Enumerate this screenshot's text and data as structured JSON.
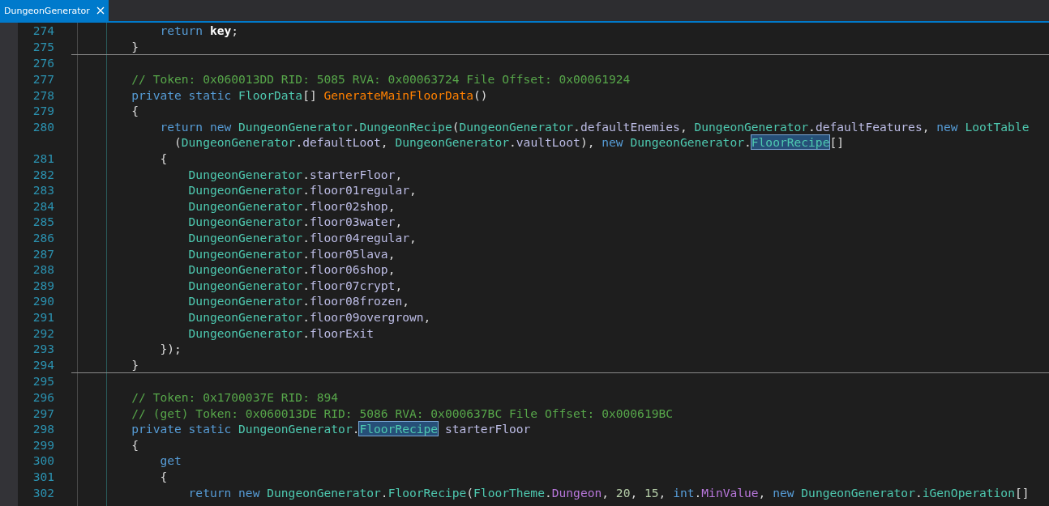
{
  "tabs": [
    {
      "label": "DungeonGenerator",
      "selected": true
    }
  ],
  "lines": [
    {
      "number": "274",
      "separator_below": false,
      "tokens": [
        {
          "kind": "keyword",
          "text": "            return"
        },
        {
          "kind": "bold",
          "text": " key"
        },
        {
          "kind": "plain",
          "text": ";"
        }
      ]
    },
    {
      "number": "275",
      "separator_below": true,
      "tokens": [
        {
          "kind": "plain",
          "text": "        }"
        }
      ]
    },
    {
      "number": "276",
      "separator_below": false
    },
    {
      "number": "277",
      "separator_below": false,
      "tokens": [
        {
          "kind": "comment",
          "text": "        // Token: 0x060013DD RID: 5085 RVA: 0x00063724 File Offset: 0x00061924"
        }
      ]
    },
    {
      "number": "278",
      "separator_below": false,
      "tokens": [
        {
          "kind": "keyword",
          "text": "        private static"
        },
        {
          "kind": "type",
          "text": " FloorData"
        },
        {
          "kind": "plain",
          "text": "[] "
        },
        {
          "kind": "method",
          "text": "GenerateMainFloorData"
        },
        {
          "kind": "plain",
          "text": "()"
        }
      ]
    },
    {
      "number": "279",
      "separator_below": false,
      "tokens": [
        {
          "kind": "plain",
          "text": "        {"
        }
      ]
    },
    {
      "number": "280",
      "separator_below": false,
      "tokens": [
        {
          "kind": "keyword",
          "text": "            return new"
        },
        {
          "kind": "type",
          "text": " DungeonGenerator"
        },
        {
          "kind": "plain",
          "text": "."
        },
        {
          "kind": "type",
          "text": "DungeonRecipe"
        },
        {
          "kind": "plain",
          "text": "("
        },
        {
          "kind": "type",
          "text": "DungeonGenerator"
        },
        {
          "kind": "plain",
          "text": "."
        },
        {
          "kind": "field",
          "text": "defaultEnemies"
        },
        {
          "kind": "plain",
          "text": ", "
        },
        {
          "kind": "type",
          "text": "DungeonGenerator"
        },
        {
          "kind": "plain",
          "text": "."
        },
        {
          "kind": "field",
          "text": "defaultFeatures"
        },
        {
          "kind": "plain",
          "text": ", "
        },
        {
          "kind": "keyword",
          "text": "new"
        },
        {
          "kind": "type",
          "text": " LootTable"
        }
      ]
    },
    {
      "separator_below": false,
      "tokens": [
        {
          "kind": "plain",
          "text": "              ("
        },
        {
          "kind": "type",
          "text": "DungeonGenerator"
        },
        {
          "kind": "plain",
          "text": "."
        },
        {
          "kind": "field",
          "text": "defaultLoot"
        },
        {
          "kind": "plain",
          "text": ", "
        },
        {
          "kind": "type",
          "text": "DungeonGenerator"
        },
        {
          "kind": "plain",
          "text": "."
        },
        {
          "kind": "field",
          "text": "vaultLoot"
        },
        {
          "kind": "plain",
          "text": "), "
        },
        {
          "kind": "keyword",
          "text": "new"
        },
        {
          "kind": "type",
          "text": " DungeonGenerator"
        },
        {
          "kind": "plain",
          "text": "."
        },
        {
          "kind": "highlight",
          "text": "FloorRecipe"
        },
        {
          "kind": "plain",
          "text": "[]"
        }
      ]
    },
    {
      "number": "281",
      "separator_below": false,
      "tokens": [
        {
          "kind": "plain",
          "text": "            {"
        }
      ]
    },
    {
      "number": "282",
      "separator_below": false,
      "tokens": [
        {
          "kind": "type",
          "text": "                DungeonGenerator"
        },
        {
          "kind": "plain",
          "text": "."
        },
        {
          "kind": "field",
          "text": "starterFloor"
        },
        {
          "kind": "plain",
          "text": ","
        }
      ]
    },
    {
      "number": "283",
      "separator_below": false,
      "tokens": [
        {
          "kind": "type",
          "text": "                DungeonGenerator"
        },
        {
          "kind": "plain",
          "text": "."
        },
        {
          "kind": "field",
          "text": "floor01regular"
        },
        {
          "kind": "plain",
          "text": ","
        }
      ]
    },
    {
      "number": "284",
      "separator_below": false,
      "tokens": [
        {
          "kind": "type",
          "text": "                DungeonGenerator"
        },
        {
          "kind": "plain",
          "text": "."
        },
        {
          "kind": "field",
          "text": "floor02shop"
        },
        {
          "kind": "plain",
          "text": ","
        }
      ]
    },
    {
      "number": "285",
      "separator_below": false,
      "tokens": [
        {
          "kind": "type",
          "text": "                DungeonGenerator"
        },
        {
          "kind": "plain",
          "text": "."
        },
        {
          "kind": "field",
          "text": "floor03water"
        },
        {
          "kind": "plain",
          "text": ","
        }
      ]
    },
    {
      "number": "286",
      "separator_below": false,
      "tokens": [
        {
          "kind": "type",
          "text": "                DungeonGenerator"
        },
        {
          "kind": "plain",
          "text": "."
        },
        {
          "kind": "field",
          "text": "floor04regular"
        },
        {
          "kind": "plain",
          "text": ","
        }
      ]
    },
    {
      "number": "287",
      "separator_below": false,
      "tokens": [
        {
          "kind": "type",
          "text": "                DungeonGenerator"
        },
        {
          "kind": "plain",
          "text": "."
        },
        {
          "kind": "field",
          "text": "floor05lava"
        },
        {
          "kind": "plain",
          "text": ","
        }
      ]
    },
    {
      "number": "288",
      "separator_below": false,
      "tokens": [
        {
          "kind": "type",
          "text": "                DungeonGenerator"
        },
        {
          "kind": "plain",
          "text": "."
        },
        {
          "kind": "field",
          "text": "floor06shop"
        },
        {
          "kind": "plain",
          "text": ","
        }
      ]
    },
    {
      "number": "289",
      "separator_below": false,
      "tokens": [
        {
          "kind": "type",
          "text": "                DungeonGenerator"
        },
        {
          "kind": "plain",
          "text": "."
        },
        {
          "kind": "field",
          "text": "floor07crypt"
        },
        {
          "kind": "plain",
          "text": ","
        }
      ]
    },
    {
      "number": "290",
      "separator_below": false,
      "tokens": [
        {
          "kind": "type",
          "text": "                DungeonGenerator"
        },
        {
          "kind": "plain",
          "text": "."
        },
        {
          "kind": "field",
          "text": "floor08frozen"
        },
        {
          "kind": "plain",
          "text": ","
        }
      ]
    },
    {
      "number": "291",
      "separator_below": false,
      "tokens": [
        {
          "kind": "type",
          "text": "                DungeonGenerator"
        },
        {
          "kind": "plain",
          "text": "."
        },
        {
          "kind": "field",
          "text": "floor09overgrown"
        },
        {
          "kind": "plain",
          "text": ","
        }
      ]
    },
    {
      "number": "292",
      "separator_below": false,
      "tokens": [
        {
          "kind": "type",
          "text": "                DungeonGenerator"
        },
        {
          "kind": "plain",
          "text": "."
        },
        {
          "kind": "field",
          "text": "floorExit"
        }
      ]
    },
    {
      "number": "293",
      "separator_below": false,
      "tokens": [
        {
          "kind": "plain",
          "text": "            });"
        }
      ]
    },
    {
      "number": "294",
      "separator_below": true,
      "tokens": [
        {
          "kind": "plain",
          "text": "        }"
        }
      ]
    },
    {
      "number": "295",
      "separator_below": false
    },
    {
      "number": "296",
      "separator_below": false,
      "tokens": [
        {
          "kind": "comment",
          "text": "        // Token: 0x1700037E RID: 894"
        }
      ]
    },
    {
      "number": "297",
      "separator_below": false,
      "tokens": [
        {
          "kind": "comment",
          "text": "        // (get) Token: 0x060013DE RID: 5086 RVA: 0x000637BC File Offset: 0x000619BC"
        }
      ]
    },
    {
      "number": "298",
      "separator_below": false,
      "tokens": [
        {
          "kind": "keyword",
          "text": "        private static"
        },
        {
          "kind": "type",
          "text": " DungeonGenerator"
        },
        {
          "kind": "plain",
          "text": "."
        },
        {
          "kind": "highlight",
          "text": "FloorRecipe"
        },
        {
          "kind": "field",
          "text": " starterFloor"
        }
      ]
    },
    {
      "number": "299",
      "separator_below": false,
      "tokens": [
        {
          "kind": "plain",
          "text": "        {"
        }
      ]
    },
    {
      "number": "300",
      "separator_below": false,
      "tokens": [
        {
          "kind": "keyword",
          "text": "            get"
        }
      ]
    },
    {
      "number": "301",
      "separator_below": false,
      "tokens": [
        {
          "kind": "plain",
          "text": "            {"
        }
      ]
    },
    {
      "number": "302",
      "separator_below": false,
      "tokens": [
        {
          "kind": "keyword",
          "text": "                return new"
        },
        {
          "kind": "type",
          "text": " DungeonGenerator"
        },
        {
          "kind": "plain",
          "text": "."
        },
        {
          "kind": "type",
          "text": "FloorRecipe"
        },
        {
          "kind": "plain",
          "text": "("
        },
        {
          "kind": "type",
          "text": "FloorTheme"
        },
        {
          "kind": "plain",
          "text": "."
        },
        {
          "kind": "enum",
          "text": "Dungeon"
        },
        {
          "kind": "plain",
          "text": ", "
        },
        {
          "kind": "number",
          "text": "20"
        },
        {
          "kind": "plain",
          "text": ", "
        },
        {
          "kind": "number",
          "text": "15"
        },
        {
          "kind": "plain",
          "text": ", "
        },
        {
          "kind": "keyword",
          "text": "int"
        },
        {
          "kind": "plain",
          "text": "."
        },
        {
          "kind": "enum",
          "text": "MinValue"
        },
        {
          "kind": "plain",
          "text": ", "
        },
        {
          "kind": "keyword",
          "text": "new"
        },
        {
          "kind": "type",
          "text": " DungeonGenerator"
        },
        {
          "kind": "plain",
          "text": "."
        },
        {
          "kind": "type",
          "text": "iGenOperation"
        },
        {
          "kind": "plain",
          "text": "[]"
        }
      ]
    }
  ]
}
